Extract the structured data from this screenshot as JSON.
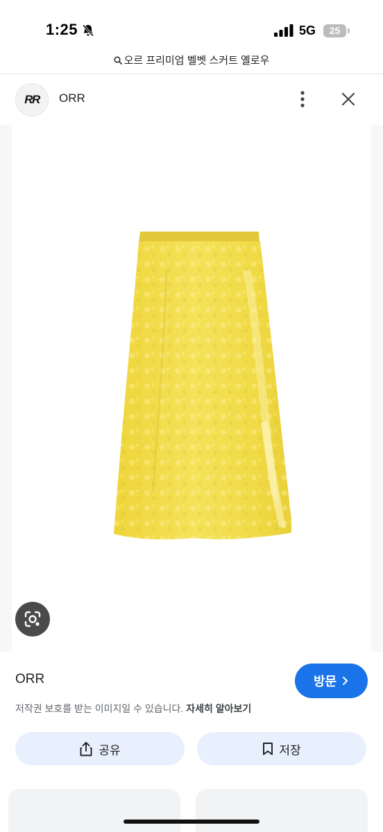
{
  "status_bar": {
    "time": "1:25",
    "network": "5G",
    "battery": "25",
    "icons": [
      "bell-slash-icon",
      "signal-bars-icon",
      "battery-icon"
    ]
  },
  "search": {
    "query": "오르 프리미엄 벨벳 스커트 옐로우",
    "icon": "search-icon"
  },
  "header": {
    "logo_text": "RR",
    "site_name": "ORR",
    "icons": [
      "more-vert-icon",
      "close-icon"
    ]
  },
  "image": {
    "subject": "yellow velvet midi skirt",
    "skirt_color": "#f2dc4a",
    "lens_icon": "lens-icon"
  },
  "info": {
    "source": "ORR",
    "visit_label": "방문",
    "copyright_text": "저작권 보호를 받는 이미지일 수 있습니다.",
    "learn_more": "자세히 알아보기"
  },
  "actions": {
    "share_label": "공유",
    "save_label": "저장"
  },
  "colors": {
    "accent": "#1a73e8",
    "pill_bg": "#e8f0fe"
  }
}
